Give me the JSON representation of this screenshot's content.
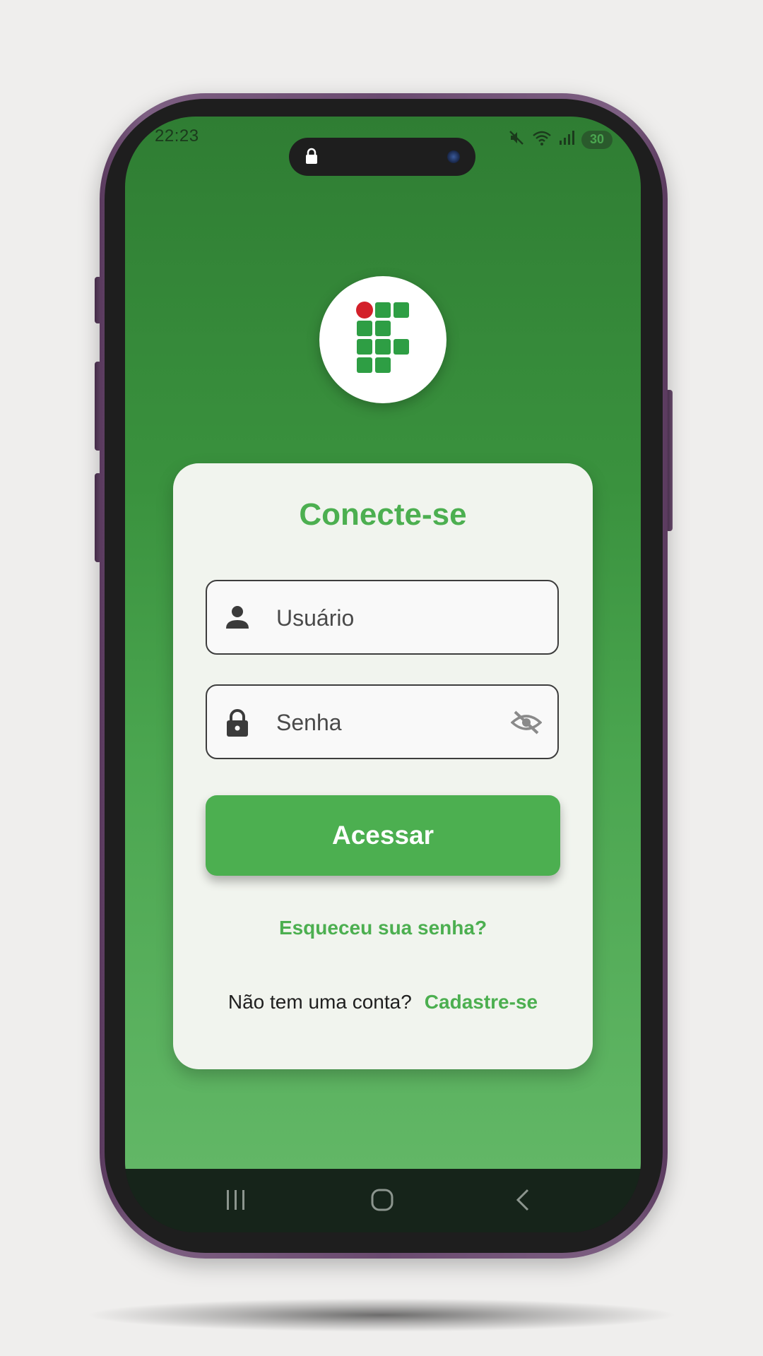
{
  "status_bar": {
    "time": "22:23",
    "battery_level": "30",
    "icons": [
      "mute-icon",
      "wifi-icon",
      "signal-icon",
      "battery-icon"
    ]
  },
  "logo": {
    "icon": "institution-logo",
    "colors": {
      "green": "#2e9e44",
      "red": "#d3202a"
    }
  },
  "login": {
    "title": "Conecte-se",
    "username_placeholder": "Usuário",
    "password_placeholder": "Senha",
    "submit_label": "Acessar",
    "forgot_label": "Esqueceu sua senha?",
    "signup_prompt": "Não tem uma conta?",
    "signup_link": "Cadastre-se"
  },
  "nav": {
    "items": [
      "recents-icon",
      "home-icon",
      "back-icon"
    ]
  },
  "colors": {
    "accent": "#4caf50",
    "background_top": "#2f7d33",
    "background_bottom": "#62b766",
    "card": "#f1f4ee"
  }
}
